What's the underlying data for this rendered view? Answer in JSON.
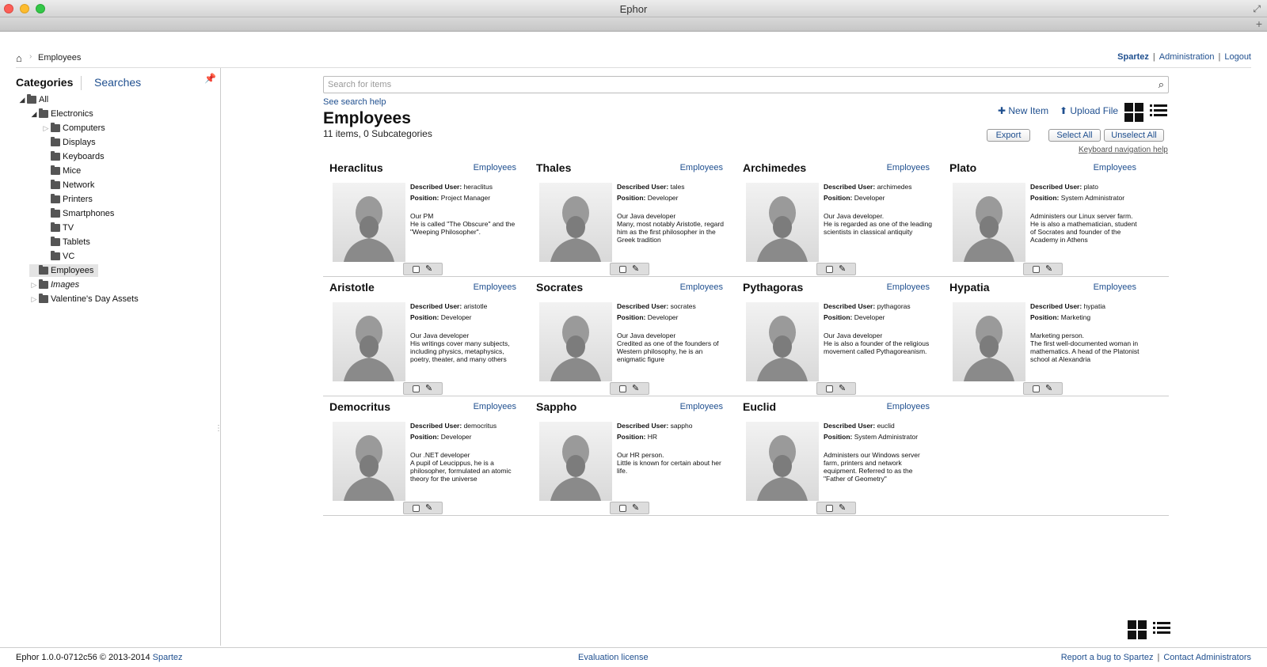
{
  "window": {
    "title": "Ephor"
  },
  "breadcrumb": {
    "current": "Employees"
  },
  "user_links": {
    "user": "Spartez",
    "admin": "Administration",
    "logout": "Logout"
  },
  "sidebar": {
    "tab_categories": "Categories",
    "tab_searches": "Searches",
    "tree": [
      {
        "label": "All",
        "toggle": "open"
      },
      {
        "label": "Electronics",
        "toggle": "open"
      },
      {
        "label": "Computers",
        "toggle": "closed"
      },
      {
        "label": "Displays",
        "toggle": "none"
      },
      {
        "label": "Keyboards",
        "toggle": "none"
      },
      {
        "label": "Mice",
        "toggle": "none"
      },
      {
        "label": "Network",
        "toggle": "none"
      },
      {
        "label": "Printers",
        "toggle": "none"
      },
      {
        "label": "Smartphones",
        "toggle": "none"
      },
      {
        "label": "TV",
        "toggle": "none"
      },
      {
        "label": "Tablets",
        "toggle": "none"
      },
      {
        "label": "VC",
        "toggle": "none"
      },
      {
        "label": "Employees",
        "toggle": "none",
        "selected": true
      },
      {
        "label": "Images",
        "toggle": "closed",
        "italic": true
      },
      {
        "label": "Valentine's Day Assets",
        "toggle": "closed"
      }
    ]
  },
  "main": {
    "search_placeholder": "Search for items",
    "search_help": "See search help",
    "title": "Employees",
    "subtitle": "11 items, 0 Subcategories",
    "new_item": "New Item",
    "upload_file": "Upload File",
    "export": "Export",
    "select_all": "Select All",
    "unselect_all": "Unselect All",
    "keyboard_help": "Keyboard navigation help"
  },
  "fields": {
    "described_user": "Described User:",
    "position": "Position:"
  },
  "items": [
    {
      "name": "Heraclitus",
      "category": "Employees",
      "user": "heraclitus",
      "position": "Project Manager",
      "desc": [
        "Our PM",
        "He is called \"The Obscure\" and the \"Weeping Philosopher\"."
      ]
    },
    {
      "name": "Thales",
      "category": "Employees",
      "user": "tales",
      "position": "Developer",
      "desc": [
        "Our Java developer",
        "Many, most notably Aristotle, regard him as the first philosopher in the Greek tradition"
      ]
    },
    {
      "name": "Archimedes",
      "category": "Employees",
      "user": "archimedes",
      "position": "Developer",
      "desc": [
        "Our Java developer.",
        "He is regarded as one of the leading scientists in classical antiquity"
      ]
    },
    {
      "name": "Plato",
      "category": "Employees",
      "user": "plato",
      "position": "System Administrator",
      "desc": [
        "Administers our Linux server farm.",
        "He is also a mathematician, student of Socrates and founder of the Academy in Athens"
      ]
    },
    {
      "name": "Aristotle",
      "category": "Employees",
      "user": "aristotle",
      "position": "Developer",
      "desc": [
        "Our Java developer",
        "His writings cover many subjects, including physics, metaphysics, poetry, theater, and many others"
      ]
    },
    {
      "name": "Socrates",
      "category": "Employees",
      "user": "socrates",
      "position": "Developer",
      "desc": [
        "Our Java developer",
        "Credited as one of the founders of Western philosophy, he is an enigmatic figure"
      ]
    },
    {
      "name": "Pythagoras",
      "category": "Employees",
      "user": "pythagoras",
      "position": "Developer",
      "desc": [
        "Our Java developer",
        "He is also a founder of the religious movement called Pythagoreanism."
      ]
    },
    {
      "name": "Hypatia",
      "category": "Employees",
      "user": "hypatia",
      "position": "Marketing",
      "desc": [
        "Marketing person.",
        "The first well-documented woman in mathematics. A head of the Platonist school at Alexandria"
      ]
    },
    {
      "name": "Democritus",
      "category": "Employees",
      "user": "democritus",
      "position": "Developer",
      "desc": [
        "Our .NET developer",
        "A pupil of Leucippus, he is a philosopher, formulated an atomic theory for the universe"
      ]
    },
    {
      "name": "Sappho",
      "category": "Employees",
      "user": "sappho",
      "position": "HR",
      "desc": [
        "Our HR person.",
        "Little is known for certain about her life."
      ]
    },
    {
      "name": "Euclid",
      "category": "Employees",
      "user": "euclid",
      "position": "System Administrator",
      "desc": [
        "Administers our Windows server farm, printers and network equipment. Referred to as the \"Father of Geometry\""
      ]
    }
  ],
  "footer": {
    "version": "Ephor 1.0.0-0712c56 © 2013-2014",
    "company": "Spartez",
    "license": "Evaluation license",
    "report_bug": "Report a bug to Spartez",
    "contact": "Contact Administrators"
  }
}
